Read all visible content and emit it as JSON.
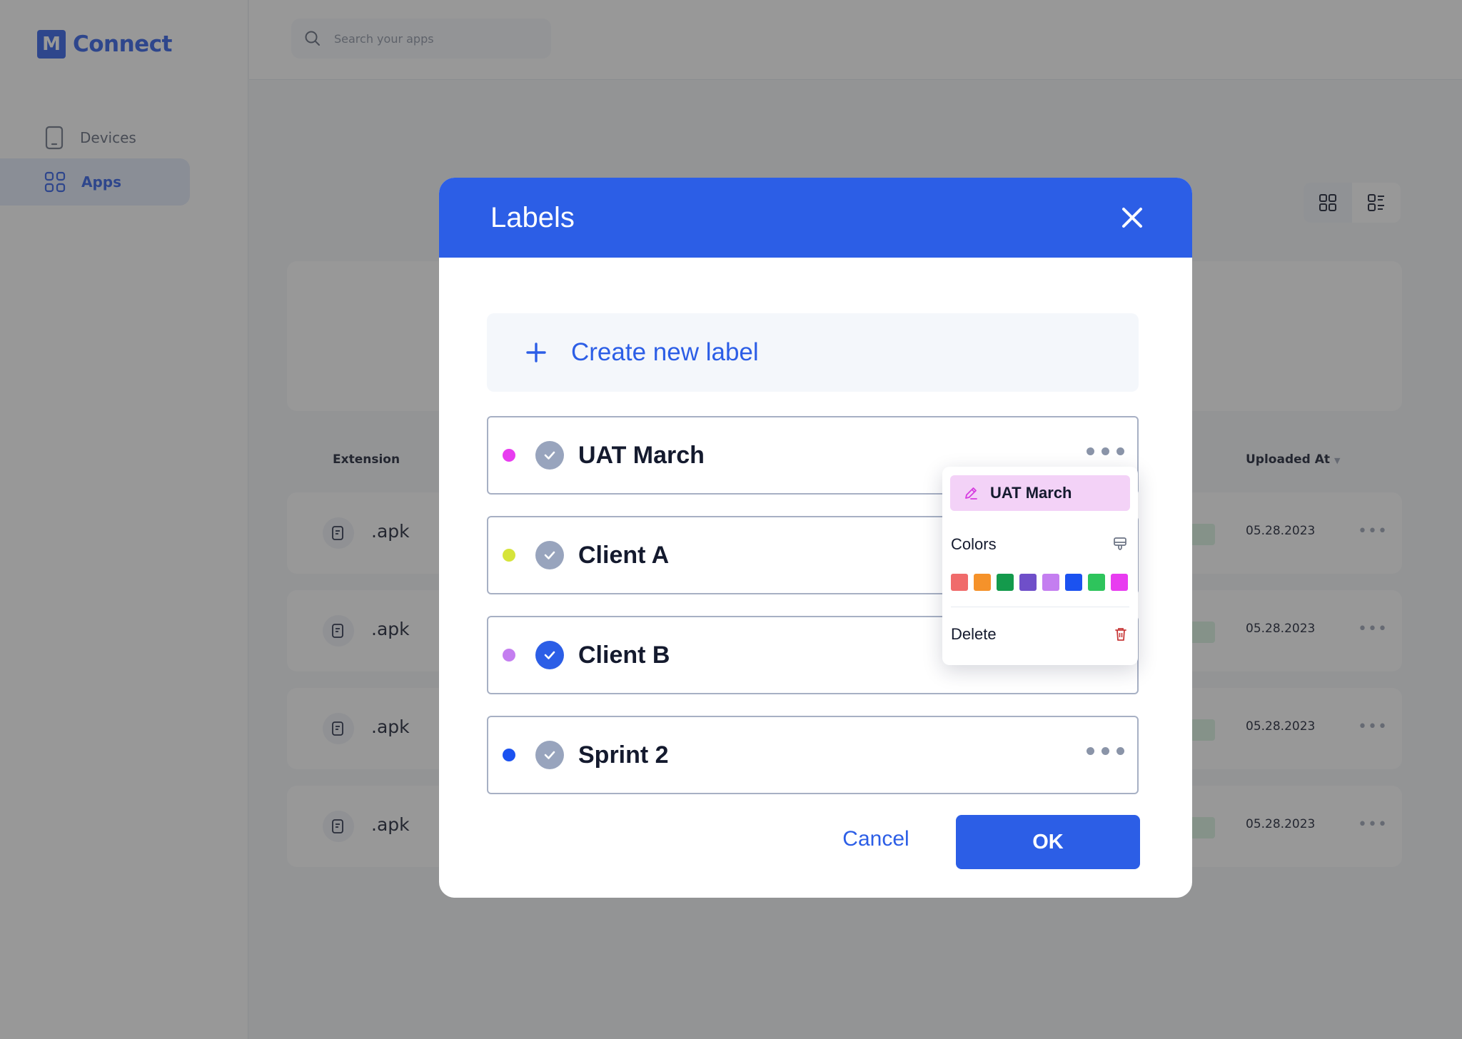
{
  "app": {
    "logo_letter": "M",
    "name": "Connect"
  },
  "sidebar": {
    "items": [
      {
        "label": "Devices",
        "icon": "phone-icon",
        "active": false
      },
      {
        "label": "Apps",
        "icon": "grid-icon",
        "active": true
      }
    ]
  },
  "search": {
    "placeholder": "Search your apps"
  },
  "table": {
    "headers": {
      "extension": "Extension",
      "uploaded_at": "Uploaded At"
    },
    "rows": [
      {
        "ext": ".apk",
        "date": "05.28.2023"
      },
      {
        "ext": ".apk",
        "date": "05.28.2023"
      },
      {
        "ext": ".apk",
        "date": "05.28.2023"
      },
      {
        "ext": ".apk",
        "date": "05.28.2023"
      }
    ]
  },
  "modal": {
    "title": "Labels",
    "create_label": "Create new label",
    "labels": [
      {
        "name": "UAT March",
        "color": "#e83cf0",
        "checked": false
      },
      {
        "name": "Client A",
        "color": "#d6e43a",
        "checked": false
      },
      {
        "name": "Client B",
        "color": "#c47ef0",
        "checked": true
      },
      {
        "name": "Sprint 2",
        "color": "#1b52f0",
        "checked": false
      }
    ],
    "cancel": "Cancel",
    "ok": "OK"
  },
  "popup": {
    "label_value": "UAT March",
    "colors_title": "Colors",
    "swatches": [
      "#f06b6b",
      "#f5922a",
      "#149a4c",
      "#6f4fc9",
      "#c47ef0",
      "#1b52f0",
      "#2ec45c",
      "#e83cf0"
    ],
    "delete": "Delete"
  },
  "colors": {
    "accent": "#2c5ee6",
    "header": "#2c5ee6"
  }
}
